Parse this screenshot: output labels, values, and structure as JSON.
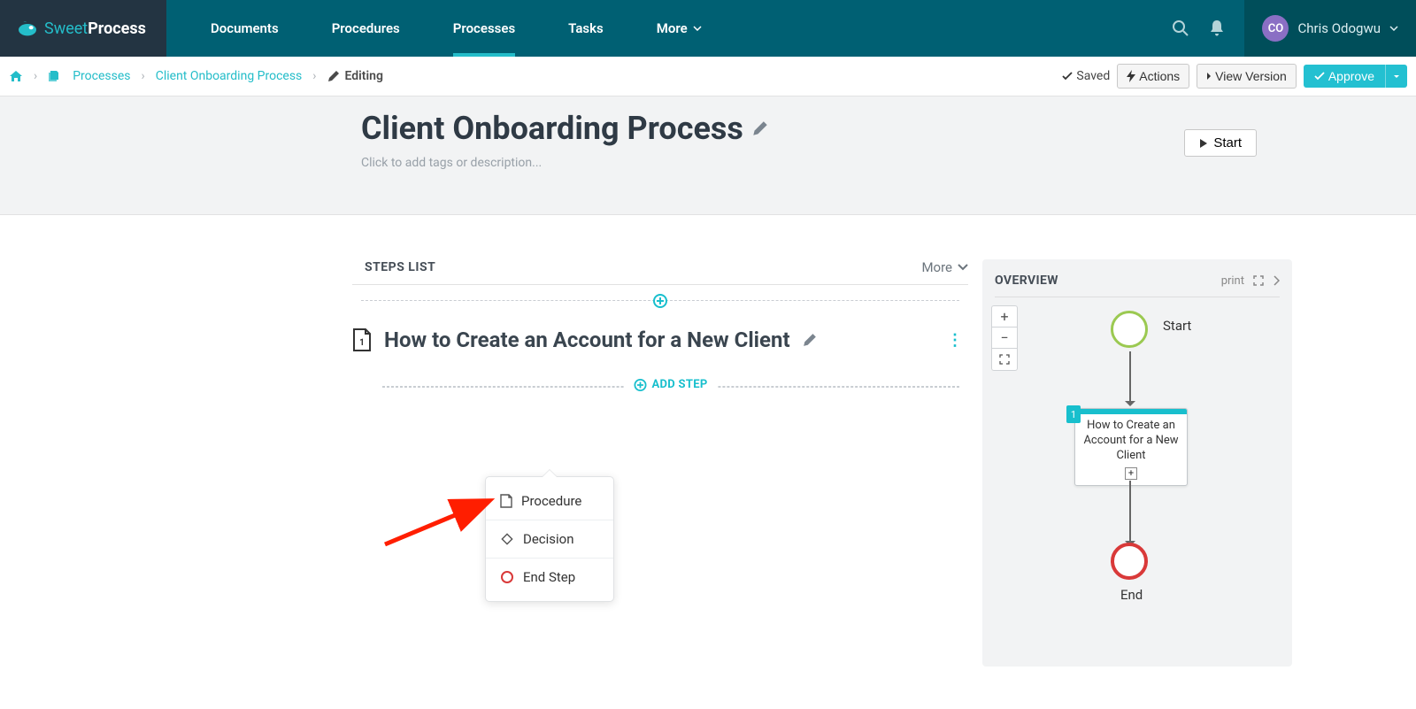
{
  "brand": {
    "sweet": "Sweet",
    "process": "Process"
  },
  "nav": {
    "documents": "Documents",
    "procedures": "Procedures",
    "processes": "Processes",
    "tasks": "Tasks",
    "more": "More"
  },
  "user": {
    "initials": "CO",
    "name": "Chris Odogwu"
  },
  "breadcrumb": {
    "processes": "Processes",
    "process_name": "Client Onboarding Process",
    "editing": "Editing"
  },
  "actions": {
    "saved": "Saved",
    "actions": "Actions",
    "view_version": "View Version",
    "approve": "Approve"
  },
  "page": {
    "title": "Client Onboarding Process",
    "tag_hint": "Click to add tags or description...",
    "start": "Start"
  },
  "steps": {
    "header": "STEPS LIST",
    "more": "More",
    "step1_title": "How to Create an Account for a New Client",
    "add_step": "ADD STEP"
  },
  "popover": {
    "procedure": "Procedure",
    "decision": "Decision",
    "endstep": "End Step"
  },
  "overview": {
    "title": "OVERVIEW",
    "print": "print",
    "start": "Start",
    "card": "How to Create an Account for a New Client",
    "card_num": "1",
    "end": "End",
    "plus": "+",
    "minus": "−"
  }
}
